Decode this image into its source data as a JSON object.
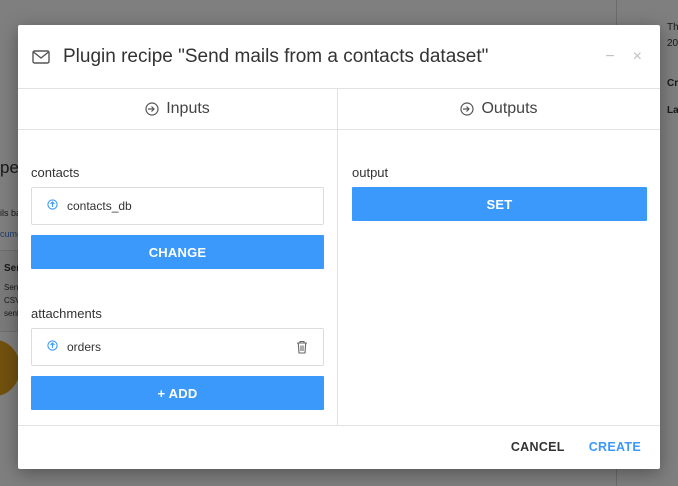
{
  "background": {
    "title_fragment": "pe i",
    "left_lines": [
      "ils ba",
      "cume"
    ],
    "card_lines": [
      "Ser",
      "Send",
      "CSV",
      "sent"
    ],
    "right_lines": [
      "Th",
      "20",
      "Cr",
      "La"
    ]
  },
  "modal": {
    "title": "Plugin recipe \"Send mails from a contacts dataset\"",
    "minimize_label": "−",
    "close_label": "×",
    "tabs": {
      "inputs": "Inputs",
      "outputs": "Outputs"
    },
    "inputs": {
      "contacts": {
        "label": "contacts",
        "dataset": "contacts_db",
        "button": "CHANGE"
      },
      "attachments": {
        "label": "attachments",
        "dataset": "orders",
        "button": "+ ADD"
      }
    },
    "outputs": {
      "output": {
        "label": "output",
        "button": "SET"
      }
    },
    "footer": {
      "cancel": "CANCEL",
      "create": "CREATE"
    }
  },
  "colors": {
    "accent": "#3b99fc",
    "overlay": "rgba(0,0,0,0.5)"
  }
}
